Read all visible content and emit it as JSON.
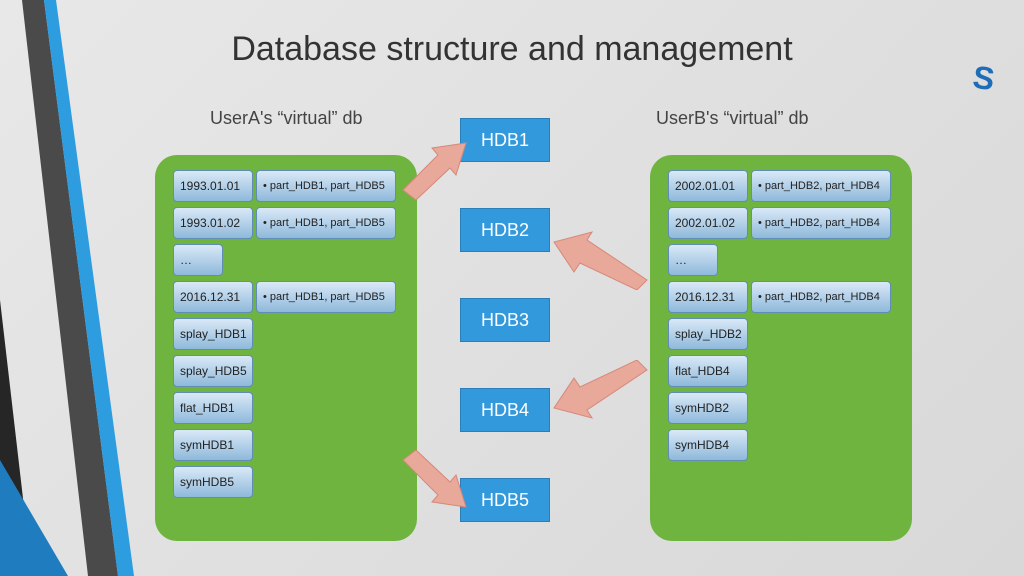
{
  "title": "Database structure and management",
  "logo_text": "S",
  "left_subtitle": "UserA's “virtual” db",
  "right_subtitle": "UserB's “virtual” db",
  "hdb_boxes": [
    "HDB1",
    "HDB2",
    "HDB3",
    "HDB4",
    "HDB5"
  ],
  "userA": {
    "rows": [
      {
        "date": "1993.01.01",
        "desc": "• part_HDB1, part_HDB5"
      },
      {
        "date": "1993.01.02",
        "desc": "• part_HDB1, part_HDB5"
      },
      {
        "date": "…",
        "desc": ""
      },
      {
        "date": "2016.12.31",
        "desc": "• part_HDB1, part_HDB5"
      }
    ],
    "splay": [
      "splay_HDB1",
      "splay_HDB5",
      "flat_HDB1",
      "symHDB1",
      "symHDB5"
    ]
  },
  "userB": {
    "rows": [
      {
        "date": "2002.01.01",
        "desc": "• part_HDB2, part_HDB4"
      },
      {
        "date": "2002.01.02",
        "desc": "• part_HDB2, part_HDB4"
      },
      {
        "date": "…",
        "desc": ""
      },
      {
        "date": "2016.12.31",
        "desc": "• part_HDB2, part_HDB4"
      }
    ],
    "splay": [
      "splay_HDB2",
      "flat_HDB4",
      "symHDB2",
      "symHDB4"
    ]
  }
}
